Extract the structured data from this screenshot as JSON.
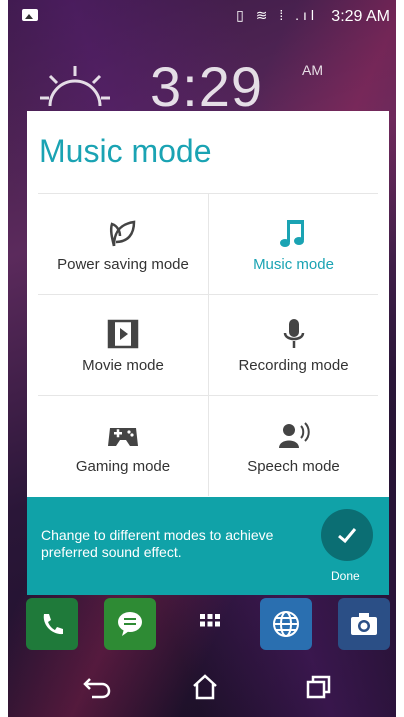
{
  "status_bar": {
    "icons": "▯ ≋ ⁞ .ıl",
    "time": "3:29 AM"
  },
  "lockscreen": {
    "clock": "3:29",
    "ampm": "AM"
  },
  "dialog": {
    "title": "Music mode",
    "modes": [
      {
        "label": "Power saving mode",
        "icon": "leaf-icon",
        "active": false
      },
      {
        "label": "Music mode",
        "icon": "music-note-icon",
        "active": true
      },
      {
        "label": "Movie mode",
        "icon": "film-icon",
        "active": false
      },
      {
        "label": "Recording mode",
        "icon": "microphone-icon",
        "active": false
      },
      {
        "label": "Gaming mode",
        "icon": "gamepad-icon",
        "active": false
      },
      {
        "label": "Speech mode",
        "icon": "speaker-icon",
        "active": false
      }
    ]
  },
  "banner": {
    "message": "Change to different modes to achieve preferred sound effect.",
    "done_label": "Done"
  },
  "dock": {
    "apps": [
      "phone-icon",
      "messages-icon",
      "apps-grid-icon",
      "browser-icon",
      "camera-icon"
    ]
  },
  "colors": {
    "accent": "#1aa3b3",
    "banner": "#10a2a8"
  }
}
